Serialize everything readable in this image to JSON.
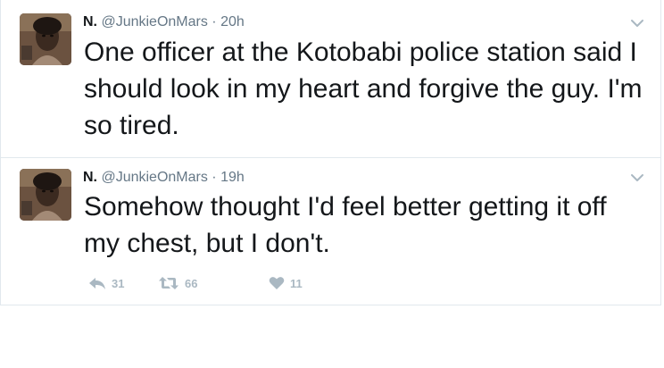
{
  "colors": {
    "text": "#14171a",
    "muted": "#657786",
    "action_icons": "#aab8c2",
    "border": "#e1e8ed"
  },
  "tweets": [
    {
      "name": "N.",
      "handle": "@JunkieOnMars",
      "separator": "·",
      "time": "20h",
      "text": "One officer at the Kotobabi police station said I should look in my heart and forgive the guy. I'm so tired.",
      "avatar_icon": "profile-photo",
      "menu_icon": "chevron-down-icon"
    },
    {
      "name": "N.",
      "handle": "@JunkieOnMars",
      "separator": "·",
      "time": "19h",
      "text": "Somehow thought I'd feel better getting it off my chest, but I don't.",
      "avatar_icon": "profile-photo",
      "menu_icon": "chevron-down-icon",
      "actions": {
        "replies": "31",
        "retweets": "66",
        "likes": "11"
      }
    }
  ]
}
